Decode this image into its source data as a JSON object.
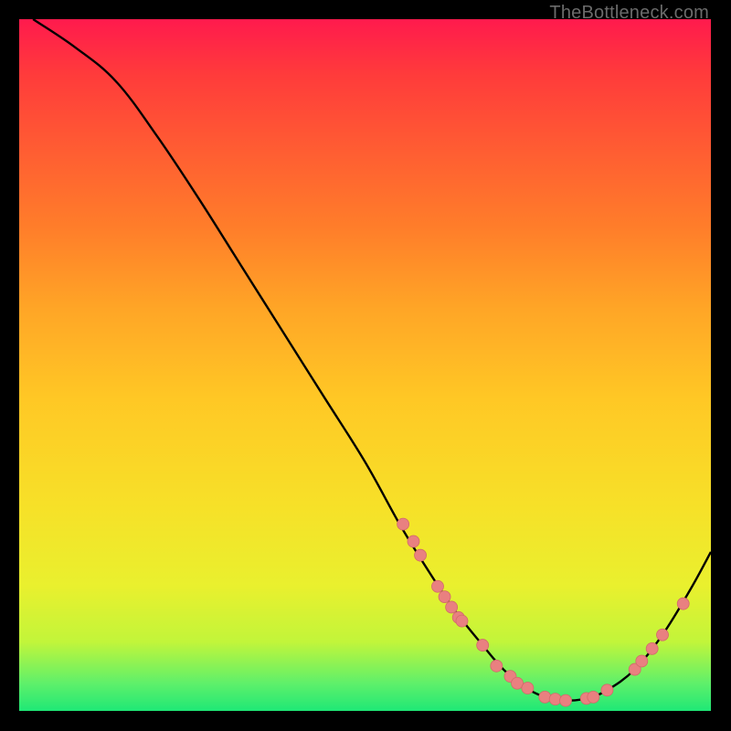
{
  "attribution": "TheBottleneck.com",
  "accent_curve_color": "#000000",
  "marker_color": "#e98080",
  "marker_stroke": "#d26a6a",
  "chart_data": {
    "type": "line",
    "title": "",
    "xlabel": "",
    "ylabel": "",
    "xlim": [
      0,
      100
    ],
    "ylim": [
      0,
      100
    ],
    "series": [
      {
        "name": "bottleneck-curve",
        "x": [
          2,
          8,
          14,
          20,
          26,
          32,
          38,
          44,
          50,
          55,
          59,
          63,
          67,
          70,
          73,
          76,
          79,
          82,
          85,
          89,
          93,
          97,
          100
        ],
        "y": [
          100,
          96,
          91,
          83,
          74,
          64.5,
          55,
          45.5,
          36,
          27,
          20.5,
          14.5,
          9.5,
          6,
          3.5,
          2,
          1.5,
          1.8,
          3,
          6,
          11,
          17.5,
          23
        ]
      }
    ],
    "markers": {
      "name": "highlight-points",
      "points": [
        {
          "x": 55.5,
          "y": 27.0
        },
        {
          "x": 57.0,
          "y": 24.5
        },
        {
          "x": 58.0,
          "y": 22.5
        },
        {
          "x": 60.5,
          "y": 18.0
        },
        {
          "x": 61.5,
          "y": 16.5
        },
        {
          "x": 62.5,
          "y": 15.0
        },
        {
          "x": 63.5,
          "y": 13.5
        },
        {
          "x": 64.0,
          "y": 13.0
        },
        {
          "x": 67.0,
          "y": 9.5
        },
        {
          "x": 69.0,
          "y": 6.5
        },
        {
          "x": 71.0,
          "y": 5.0
        },
        {
          "x": 72.0,
          "y": 4.0
        },
        {
          "x": 73.5,
          "y": 3.3
        },
        {
          "x": 76.0,
          "y": 2.0
        },
        {
          "x": 77.5,
          "y": 1.7
        },
        {
          "x": 79.0,
          "y": 1.5
        },
        {
          "x": 82.0,
          "y": 1.8
        },
        {
          "x": 83.0,
          "y": 2.0
        },
        {
          "x": 85.0,
          "y": 3.0
        },
        {
          "x": 89.0,
          "y": 6.0
        },
        {
          "x": 90.0,
          "y": 7.2
        },
        {
          "x": 91.5,
          "y": 9.0
        },
        {
          "x": 93.0,
          "y": 11.0
        },
        {
          "x": 96.0,
          "y": 15.5
        }
      ]
    }
  }
}
